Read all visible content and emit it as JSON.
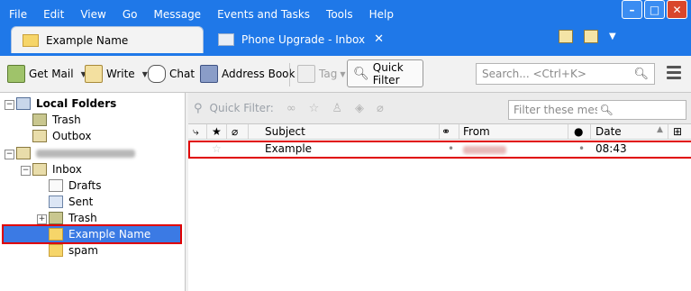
{
  "menu": [
    "File",
    "Edit",
    "View",
    "Go",
    "Message",
    "Events and Tasks",
    "Tools",
    "Help"
  ],
  "tabs": [
    {
      "label": "Example Name",
      "icon": "folder-icon"
    },
    {
      "label": "Phone Upgrade - Inbox",
      "icon": "mail-icon"
    }
  ],
  "toolbar": {
    "get_mail": "Get Mail",
    "write": "Write",
    "chat": "Chat",
    "address_book": "Address Book",
    "tag": "Tag",
    "quick_filter": "Quick Filter",
    "search_placeholder": "Search... <Ctrl+K>"
  },
  "folders": [
    {
      "label": "Local Folders",
      "icon": "computer-icon",
      "bold": true
    },
    {
      "label": "Trash",
      "icon": "trash-icon"
    },
    {
      "label": "Outbox",
      "icon": "outbox-icon"
    },
    {
      "label": "Inbox",
      "icon": "inbox-icon"
    },
    {
      "label": "Drafts",
      "icon": "drafts-icon"
    },
    {
      "label": "Sent",
      "icon": "sent-icon"
    },
    {
      "label": "Trash",
      "icon": "trash-icon"
    },
    {
      "label": "Example Name",
      "icon": "folder-icon",
      "selected": true
    },
    {
      "label": "spam",
      "icon": "folder-icon"
    }
  ],
  "quickfilter": {
    "label": "Quick Filter:",
    "placeholder": "Filter these messages... <Ctrl+Shift+K>"
  },
  "columns": {
    "subject": "Subject",
    "from": "From",
    "date": "Date"
  },
  "messages": [
    {
      "subject": "Example",
      "date": "08:43"
    }
  ],
  "colors": {
    "titlebar": "#1f78e8",
    "selection": "#3b7ae4",
    "highlight_box": "#e00000"
  }
}
